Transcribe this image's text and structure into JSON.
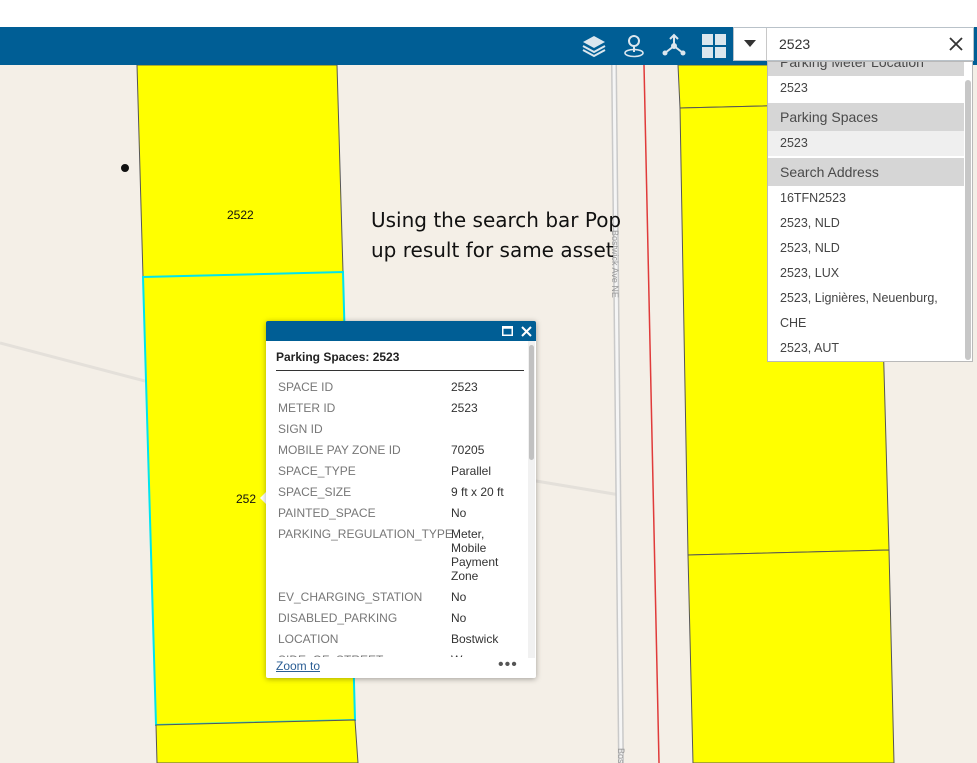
{
  "toolbar": {
    "icons": [
      "layers-icon",
      "basemap-pin-icon",
      "share-network-icon",
      "grid-apps-icon"
    ],
    "bg_color": "#005e95"
  },
  "search": {
    "value": "2523",
    "placeholder": ""
  },
  "results": {
    "rows": [
      {
        "text": "Parking Meter Location",
        "kind": "header"
      },
      {
        "text": "2523",
        "kind": "item"
      },
      {
        "text": "Parking Spaces",
        "kind": "header"
      },
      {
        "text": "2523",
        "kind": "selected"
      },
      {
        "text": "Search Address",
        "kind": "header"
      },
      {
        "text": "16TFN2523",
        "kind": "item"
      },
      {
        "text": "2523, NLD",
        "kind": "item"
      },
      {
        "text": "2523, NLD",
        "kind": "item"
      },
      {
        "text": "2523, LUX",
        "kind": "item"
      },
      {
        "text": "2523, Lignières, Neuenburg,",
        "kind": "item"
      },
      {
        "text": "CHE",
        "kind": "item"
      },
      {
        "text": "2523, AUT",
        "kind": "item"
      }
    ]
  },
  "map": {
    "parcel_labels": [
      "2522",
      "252"
    ],
    "street_label": "Bostwick Ave NE",
    "street_label_bottom": "Bos",
    "parcel_fill": "#ffff00",
    "highlight_color": "#00ffff"
  },
  "annotation": {
    "text": "Using the search bar Pop up result for same asset"
  },
  "popup": {
    "title": "Parking Spaces: 2523",
    "attributes": [
      {
        "key": "SPACE ID",
        "value": "2523"
      },
      {
        "key": "METER ID",
        "value": "2523"
      },
      {
        "key": "SIGN ID",
        "value": ""
      },
      {
        "key": "MOBILE PAY ZONE ID",
        "value": "70205"
      },
      {
        "key": "SPACE_TYPE",
        "value": "Parallel"
      },
      {
        "key": "SPACE_SIZE",
        "value": "9 ft x 20 ft"
      },
      {
        "key": "PAINTED_SPACE",
        "value": "No"
      },
      {
        "key": "PARKING_REGULATION_TYPE",
        "value": "Meter, Mobile Payment Zone"
      },
      {
        "key": "EV_CHARGING_STATION",
        "value": "No"
      },
      {
        "key": "DISABLED_PARKING",
        "value": "No"
      },
      {
        "key": "LOCATION",
        "value": "Bostwick"
      },
      {
        "key": "SIDE_OF_STREET",
        "value": "W"
      }
    ],
    "zoom_label": "Zoom to",
    "more_label": "•••"
  }
}
